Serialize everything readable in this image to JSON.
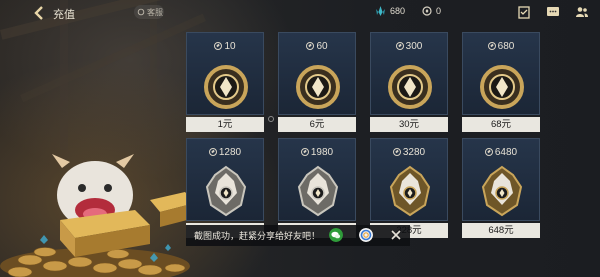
{
  "header": {
    "title": "充值",
    "service_label": "客服"
  },
  "currencies": [
    {
      "icon": "crystal-icon",
      "value": "680",
      "color": "#3fb8c8"
    },
    {
      "icon": "rp-coin-icon",
      "value": "0",
      "color": "#d8d2c4"
    }
  ],
  "top_icons": [
    "task-icon",
    "chat-icon",
    "friends-icon"
  ],
  "products": [
    {
      "amount": "10",
      "price": "1元",
      "tier": "coin"
    },
    {
      "amount": "60",
      "price": "6元",
      "tier": "coin"
    },
    {
      "amount": "300",
      "price": "30元",
      "tier": "coin"
    },
    {
      "amount": "680",
      "price": "68元",
      "tier": "coin"
    },
    {
      "amount": "1280",
      "price": "",
      "tier": "emblem"
    },
    {
      "amount": "1980",
      "price": "",
      "tier": "emblem"
    },
    {
      "amount": "3280",
      "price": "328元",
      "tier": "emblem-gold"
    },
    {
      "amount": "6480",
      "price": "648元",
      "tier": "emblem-gold"
    }
  ],
  "toast": {
    "text": "截图成功，赶紧分享给好友吧！"
  },
  "colors": {
    "card_bg": "#22304a",
    "price_bg": "#e9e7e0",
    "gold": "#c9a55a"
  }
}
